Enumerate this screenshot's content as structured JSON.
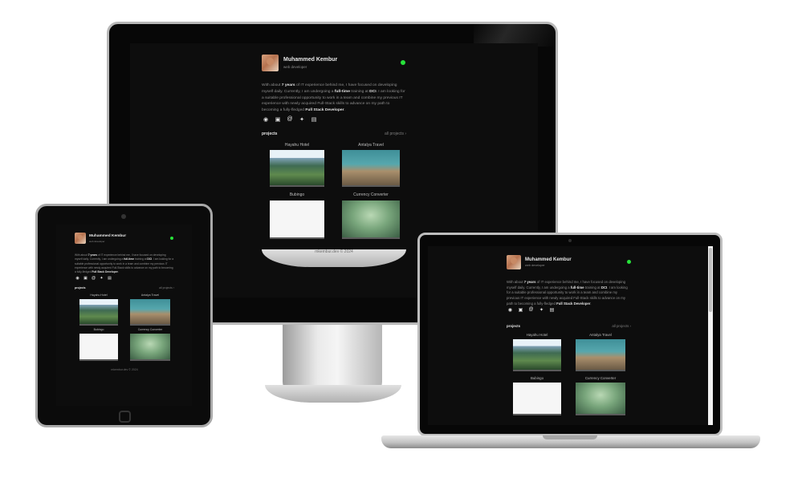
{
  "profile": {
    "name": "Muhammed Kembur",
    "role": "web developer",
    "status_color": "#27e23a"
  },
  "bio": {
    "t1": "With about ",
    "b1": "7 years",
    "t2": " of IT experience behind me, I have focused on developing myself daily. Currently, I am undergoing a ",
    "b2": "full-time",
    "t3": " training at ",
    "b3": "DCI",
    "t4": ". I am looking for a suitable professional opportunity to work in a team and combine my previous IT experience with newly acquired Full-Stack skills to advance on my path to becoming a fully-fledged ",
    "b4": "Full Stack Developer",
    "t5": "."
  },
  "socials": [
    {
      "icon": "github-icon",
      "glyph": "◉"
    },
    {
      "icon": "linkedin-icon",
      "glyph": "▣"
    },
    {
      "icon": "email-icon",
      "glyph": "@"
    },
    {
      "icon": "twitter-icon",
      "glyph": "✦"
    },
    {
      "icon": "resume-icon",
      "glyph": "▤"
    }
  ],
  "projects_section": {
    "title": "projects",
    "all_link": "all projects ›"
  },
  "projects": [
    {
      "title": "Hayahu Hotel"
    },
    {
      "title": "Antalya Travel"
    },
    {
      "title": "Bubingo"
    },
    {
      "title": "Currency Converter"
    }
  ],
  "footer": "mkembur.dev © 2024"
}
